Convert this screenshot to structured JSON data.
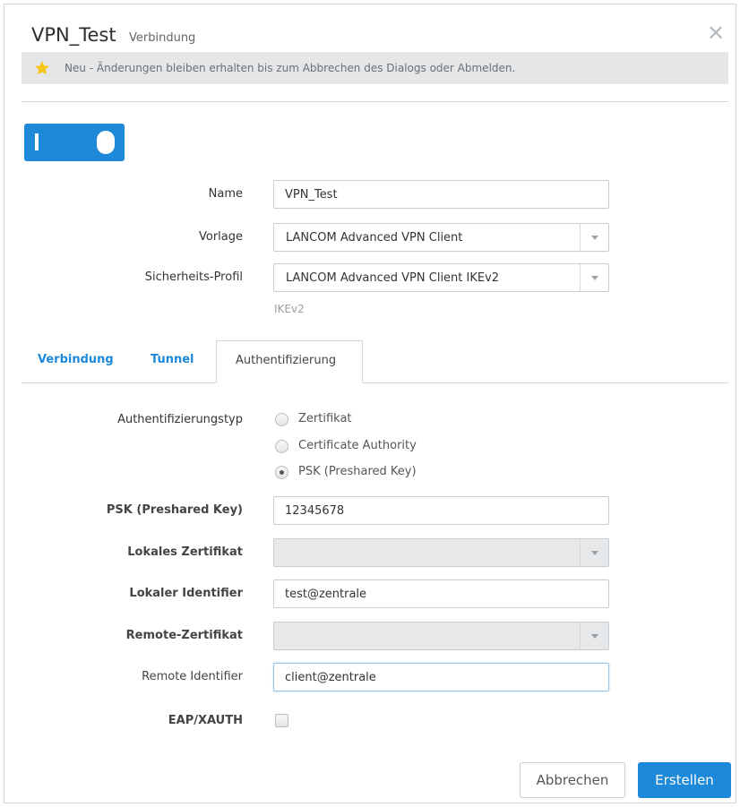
{
  "header": {
    "title": "VPN_Test",
    "subtitle": "Verbindung",
    "close_symbol": "✕"
  },
  "notice": {
    "icon": "star-icon",
    "text": "Neu - Änderungen bleiben erhalten bis zum Abbrechen des Dialogs oder Abmelden."
  },
  "toggle": {
    "enabled": true
  },
  "form": {
    "name_label": "Name",
    "name_value": "VPN_Test",
    "template_label": "Vorlage",
    "template_value": "LANCOM Advanced VPN Client",
    "security_label": "Sicherheits-Profil",
    "security_value": "LANCOM Advanced VPN Client IKEv2",
    "security_hint": "IKEv2"
  },
  "tabs": [
    {
      "label": "Verbindung"
    },
    {
      "label": "Tunnel"
    },
    {
      "label": "Authentifizierung",
      "active": true
    }
  ],
  "auth": {
    "type_label": "Authentifizierungstyp",
    "options": [
      {
        "label": "Zertifikat",
        "checked": false
      },
      {
        "label": "Certificate Authority",
        "checked": false
      },
      {
        "label": "PSK (Preshared Key)",
        "checked": true
      }
    ],
    "psk_label": "PSK (Preshared Key)",
    "psk_value": "12345678",
    "local_cert_label": "Lokales Zertifikat",
    "local_cert_value": "",
    "local_id_label": "Lokaler Identifier",
    "local_id_value": "test@zentrale",
    "remote_cert_label": "Remote-Zertifikat",
    "remote_cert_value": "",
    "remote_id_label": "Remote Identifier",
    "remote_id_value": "client@zentrale",
    "eap_label": "EAP/XAUTH",
    "eap_checked": false
  },
  "buttons": {
    "cancel": "Abbrechen",
    "create": "Erstellen"
  },
  "colors": {
    "accent": "#1e88d9",
    "star": "#f5c518"
  }
}
